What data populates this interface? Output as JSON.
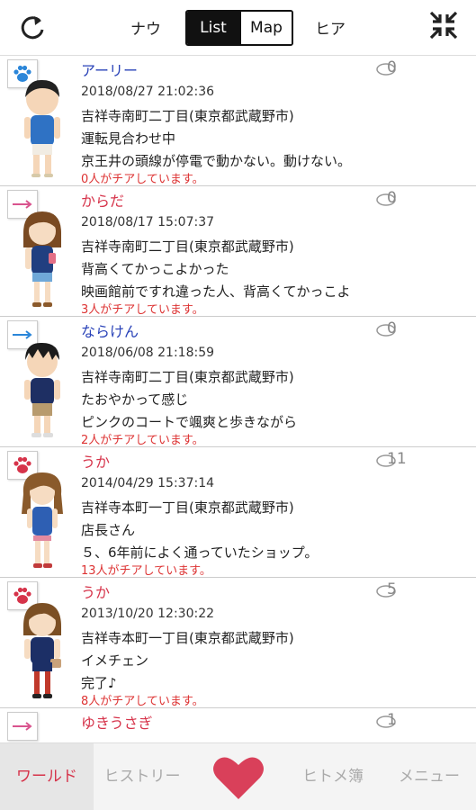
{
  "header": {
    "tab_now": "ナウ",
    "segment_list": "List",
    "segment_map": "Map",
    "tab_hear": "ヒア",
    "refresh_icon": "refresh-icon",
    "collapse_icon": "collapse-icon"
  },
  "colors": {
    "accent_red": "#d6334a",
    "link_blue": "#2a43b8",
    "cheer_red": "#dd3333"
  },
  "posts": [
    {
      "badge": "paw-icon",
      "name": "アーリー",
      "name_color": "blue",
      "comments": "0",
      "date": "2018/08/27 21:02:36",
      "place": "吉祥寺南町二丁目(東京都武蔵野市)",
      "title": "運転見合わせ中",
      "body": "京王井の頭線が停電で動かない。動けない。",
      "cheer": "0人がチアしています。"
    },
    {
      "badge": "arrow-right-pink-icon",
      "name": "からだ",
      "name_color": "red",
      "comments": "0",
      "date": "2018/08/17 15:07:37",
      "place": "吉祥寺南町二丁目(東京都武蔵野市)",
      "title": "背高くてかっこよかった",
      "body": "映画館前ですれ違った人、背高くてかっこよ",
      "cheer": "3人がチアしています。"
    },
    {
      "badge": "arrow-right-blue-icon",
      "name": "ならけん",
      "name_color": "blue",
      "comments": "0",
      "date": "2018/06/08 21:18:59",
      "place": "吉祥寺南町二丁目(東京都武蔵野市)",
      "title": "たおやかって感じ",
      "body": "ピンクのコートで颯爽と歩きながら",
      "cheer": "2人がチアしています。"
    },
    {
      "badge": "paw-icon",
      "name": "うか",
      "name_color": "red",
      "comments": "11",
      "date": "2014/04/29 15:37:14",
      "place": "吉祥寺本町一丁目(東京都武蔵野市)",
      "title": "店長さん",
      "body": "５、6年前によく通っていたショップ。",
      "cheer": "13人がチアしています。"
    },
    {
      "badge": "paw-icon",
      "name": "うか",
      "name_color": "red",
      "comments": "5",
      "date": "2013/10/20 12:30:22",
      "place": "吉祥寺本町一丁目(東京都武蔵野市)",
      "title": "イメチェン",
      "body": "完了♪",
      "cheer": "8人がチアしています。"
    },
    {
      "badge": "arrow-right-pink-icon",
      "name": "ゆきうさぎ",
      "name_color": "red",
      "comments": "1",
      "date": "",
      "place": "",
      "title": "",
      "body": "",
      "cheer": ""
    }
  ],
  "nav": {
    "world": "ワールド",
    "history": "ヒストリー",
    "heart_icon": "heart-icon",
    "hitome": "ヒトメ簿",
    "menu": "メニュー"
  }
}
